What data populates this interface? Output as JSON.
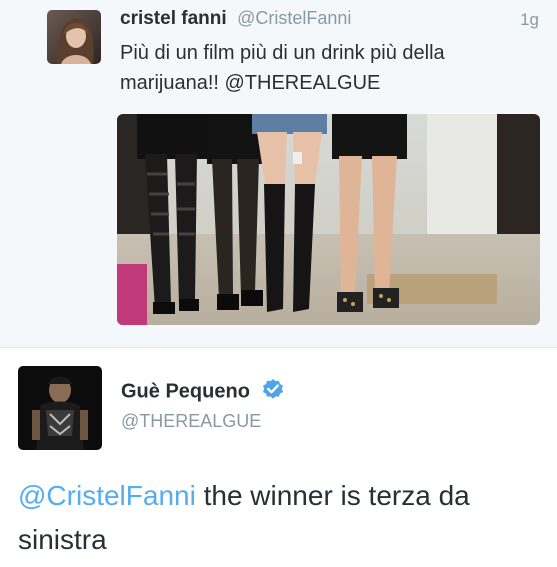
{
  "tweet1": {
    "name": "cristel fanni",
    "handle": "@CristelFanni",
    "time": "1g",
    "text": "Più di un film più di un drink più della marijuana!! @THEREALGUE"
  },
  "tweet2": {
    "name": "Guè Pequeno",
    "handle": "@THEREALGUE",
    "reply_mention": "@CristelFanni",
    "reply_text": " the winner is terza da sinistra"
  },
  "colors": {
    "link": "#55acee",
    "secondary_text": "#8899a6",
    "primary_text": "#292f33",
    "verified_badge": "#1da1f2"
  },
  "icons": {
    "verified": "verified-badge-icon"
  }
}
